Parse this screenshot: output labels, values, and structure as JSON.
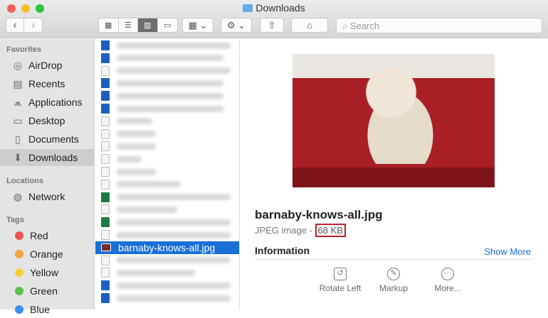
{
  "window": {
    "title": "Downloads"
  },
  "toolbar": {
    "search_placeholder": "Search"
  },
  "sidebar": {
    "sections": [
      {
        "label": "Favorites"
      },
      {
        "label": "Locations"
      },
      {
        "label": "Tags"
      }
    ],
    "favorites": [
      {
        "label": "AirDrop",
        "icon": "airdrop-icon"
      },
      {
        "label": "Recents",
        "icon": "clock-icon"
      },
      {
        "label": "Applications",
        "icon": "applications-icon"
      },
      {
        "label": "Desktop",
        "icon": "desktop-icon"
      },
      {
        "label": "Documents",
        "icon": "document-icon"
      },
      {
        "label": "Downloads",
        "icon": "download-icon",
        "selected": true
      }
    ],
    "locations": [
      {
        "label": "Network",
        "icon": "globe-icon"
      }
    ],
    "tags": [
      {
        "label": "Red",
        "color": "#f0504f"
      },
      {
        "label": "Orange",
        "color": "#f5a33b"
      },
      {
        "label": "Yellow",
        "color": "#f5cf3b"
      },
      {
        "label": "Green",
        "color": "#5bc24f"
      },
      {
        "label": "Blue",
        "color": "#3a8ef0"
      }
    ]
  },
  "files": {
    "selected": "barnaby-knows-all.jpg"
  },
  "preview": {
    "filename": "barnaby-knows-all.jpg",
    "kind": "JPEG image - ",
    "size": "68 KB",
    "info_heading": "Information",
    "show_more": "Show More",
    "actions": [
      {
        "label": "Rotate Left"
      },
      {
        "label": "Markup"
      },
      {
        "label": "More..."
      }
    ]
  }
}
